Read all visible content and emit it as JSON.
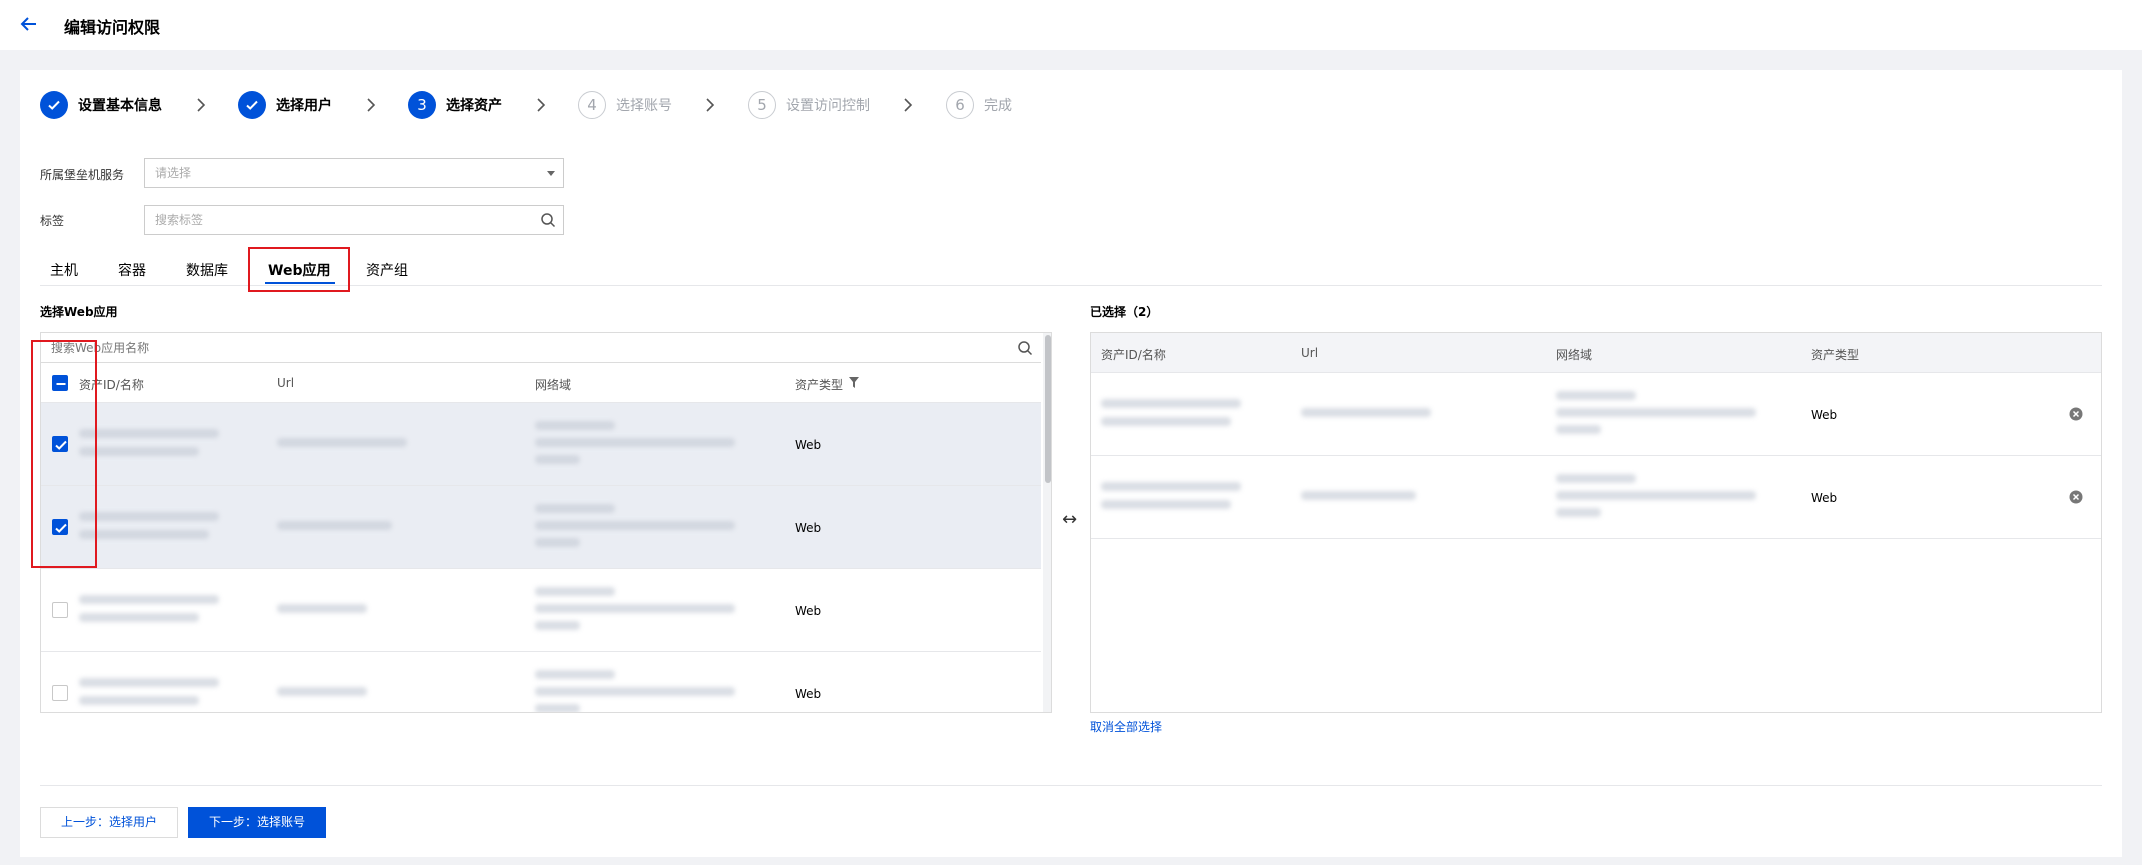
{
  "header": {
    "title": "编辑访问权限",
    "back_icon": "arrow-left-icon"
  },
  "steps": [
    {
      "num": "1",
      "label": "设置基本信息",
      "state": "done"
    },
    {
      "num": "2",
      "label": "选择用户",
      "state": "done"
    },
    {
      "num": "3",
      "label": "选择资产",
      "state": "current"
    },
    {
      "num": "4",
      "label": "选择账号",
      "state": "todo"
    },
    {
      "num": "5",
      "label": "设置访问控制",
      "state": "todo"
    },
    {
      "num": "6",
      "label": "完成",
      "state": "todo"
    }
  ],
  "filters": {
    "service_label": "所属堡垒机服务",
    "service_placeholder": "请选择",
    "tag_label": "标签",
    "tag_placeholder": "搜索标签"
  },
  "tabs": [
    "主机",
    "容器",
    "数据库",
    "Web应用",
    "资产组"
  ],
  "active_tab": "Web应用",
  "left": {
    "title": "选择Web应用",
    "search_placeholder": "搜索Web应用名称",
    "columns": [
      "资产ID/名称",
      "Url",
      "网络域",
      "资产类型"
    ],
    "rows": [
      {
        "type": "Web",
        "checked": true
      },
      {
        "type": "Web",
        "checked": true
      },
      {
        "type": "Web",
        "checked": false
      },
      {
        "type": "Web",
        "checked": false
      }
    ]
  },
  "right": {
    "title": "已选择（2）",
    "columns": [
      "资产ID/名称",
      "Url",
      "网络域",
      "资产类型"
    ],
    "rows": [
      {
        "type": "Web"
      },
      {
        "type": "Web"
      }
    ],
    "clear_all": "取消全部选择"
  },
  "swap_glyph": "↔",
  "footer": {
    "prev": "上一步：选择用户",
    "next": "下一步：选择账号"
  },
  "colors": {
    "primary": "#0052d9",
    "highlight": "#e0191f",
    "selected_row": "#eaedf3"
  }
}
